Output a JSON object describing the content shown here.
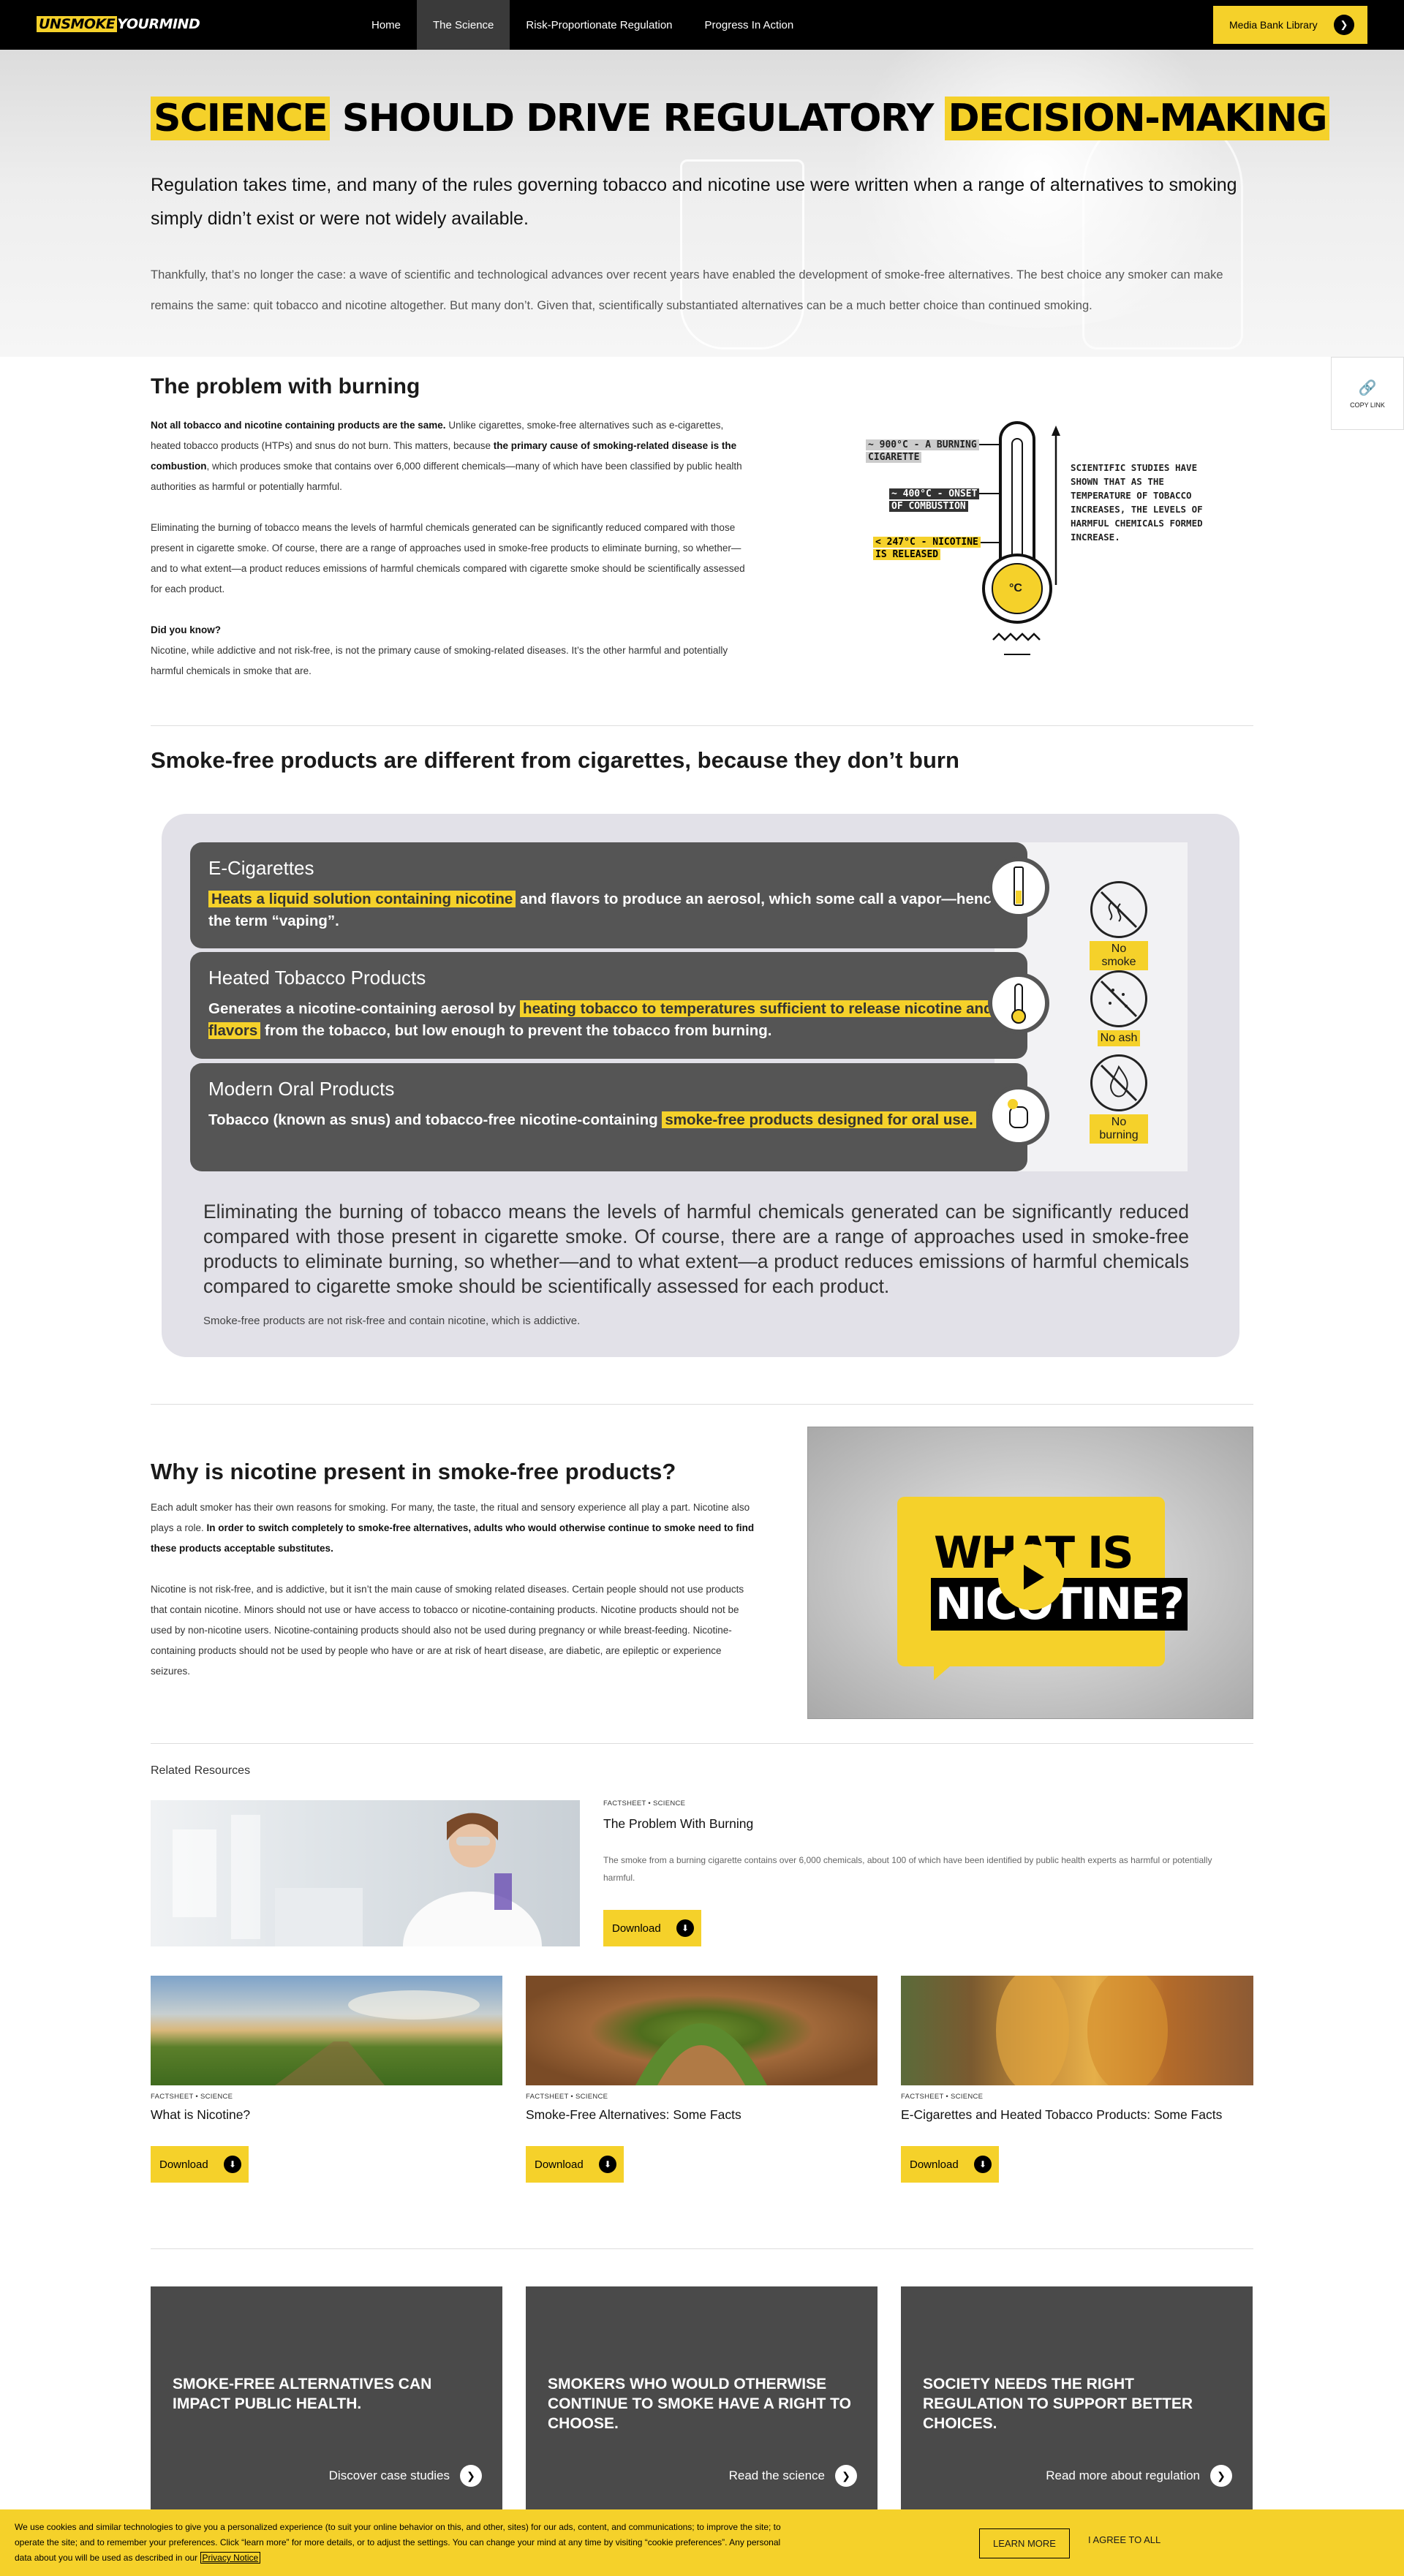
{
  "nav": {
    "logo_pre": "UNSMOKE",
    "logo_post": "YOURMIND",
    "links": [
      "Home",
      "The Science",
      "Risk-Proportionate Regulation",
      "Progress In Action"
    ],
    "media_button": "Media Bank Library"
  },
  "hero": {
    "title_hl1": "SCIENCE",
    "title_mid": " SHOULD DRIVE REGULATORY ",
    "title_hl2": "DECISION-MAKING",
    "lead": "Regulation takes time, and many of the rules governing tobacco and nicotine use were written when a range of alternatives to smoking simply didn’t exist or were not widely available.",
    "body": "Thankfully, that’s no longer the case: a wave of scientific and technological advances over recent years have enabled the development of smoke-free alternatives. The best choice any smoker can make remains the same: quit tobacco and nicotine altogether. But many don’t. Given that, scientifically substantiated alternatives can be a much better choice than continued smoking."
  },
  "copy_link": "COPY LINK",
  "problem": {
    "title": "The problem with burning",
    "p1_b1": "Not all tobacco and nicotine containing products are the same.",
    "p1_t1": " Unlike cigarettes, smoke-free alternatives such as e-cigarettes, heated tobacco products (HTPs) and snus do not burn. This matters, because ",
    "p1_b2": "the primary cause of smoking-related disease is the combustion",
    "p1_t2": ", which produces smoke that contains over 6,000 different chemicals—many of which have been classified by public health authorities as harmful or potentially harmful.",
    "p2": "Eliminating the burning of tobacco means the levels of harmful chemicals generated can be significantly reduced compared with those present in cigarette smoke. Of course, there are a range of approaches used in smoke-free products to eliminate burning, so whether—and to what extent—a product reduces emissions of harmful chemicals compared with cigarette smoke should be scientifically assessed for each product.",
    "p3_b": "Did you know?",
    "p3": "Nicotine, while addictive and not risk-free, is not the primary cause of smoking-related diseases. It’s the other harmful and potentially harmful chemicals in smoke that are."
  },
  "thermometer": {
    "l1a": "~ 900°C - A BURNING",
    "l1b": "CIGARETTE",
    "l2a": "~ 400°C - ONSET",
    "l2b": "OF COMBUSTION",
    "l3a": "< 247°C - NICOTINE",
    "l3b": "IS RELEASED",
    "note": "SCIENTIFIC STUDIES HAVE SHOWN THAT AS THE TEMPERATURE OF TOBACCO INCREASES, THE LEVELS OF HARMFUL CHEMICALS FORMED INCREASE.",
    "unit": "°C"
  },
  "smoke_free": {
    "title": "Smoke-free products are different from cigarettes, because they don’t burn",
    "cards": [
      {
        "title": "E-Cigarettes",
        "hl": "Heats a liquid solution containing nicotine",
        "rest": " and flavors to produce an aerosol, which some call a vapor—hence the term “vaping”."
      },
      {
        "title": "Heated Tobacco Products",
        "pre": "Generates a nicotine-containing aerosol by ",
        "hl": "heating tobacco to temperatures sufficient to release nicotine and flavors",
        "rest": " from the tobacco, but low enough to prevent the tobacco from burning."
      },
      {
        "title": "Modern Oral Products",
        "pre": "Tobacco (known as snus) and tobacco-free nicotine-containing ",
        "hl": "smoke-free products designed for oral use."
      }
    ],
    "badges": [
      "No smoke",
      "No ash",
      "No burning"
    ],
    "text": "Eliminating the burning of tobacco means the levels of harmful chemicals generated can be significantly reduced compared with those present in cigarette smoke. Of course, there are a range of approaches used in smoke-free products to eliminate burning, so whether—and to what extent—a product reduces emissions of harmful chemicals compared to cigarette smoke should be scientifically assessed for each product.",
    "foot": "Smoke-free products are not risk-free and contain nicotine, which is addictive."
  },
  "nicotine": {
    "title": "Why is nicotine present in smoke-free products?",
    "p1_t": "Each adult smoker has their own reasons for smoking. For many, the taste, the ritual and sensory experience all play a part. Nicotine also plays a role. ",
    "p1_b": "In order to switch completely to smoke-free alternatives, adults who would otherwise continue to smoke need to find these products acceptable substitutes.",
    "p2": "Nicotine is not risk-free, and is addictive, but it isn’t the main cause of smoking related diseases. Certain people should not use products that contain nicotine. Minors should not use or have access to tobacco or nicotine-containing products. Nicotine products should not be used by non-nicotine users. Nicotine-containing products should also not be used during pregnancy or while breast-feeding. Nicotine-containing products should not be used by people who have or are at risk of heart disease, are diabetic, are epileptic or experience seizures.",
    "video_line1": "WHAT IS",
    "video_line2": "NICOTINE?"
  },
  "resources": {
    "title": "Related Resources",
    "download": "Download",
    "featured": {
      "tag": "FACTSHEET • SCIENCE",
      "title": "The Problem With Burning",
      "desc": "The smoke from a burning cigarette contains over 6,000 chemicals, about 100 of which have been identified by public health experts as harmful or potentially harmful."
    },
    "items": [
      {
        "tag": "FACTSHEET • SCIENCE",
        "title": "What is Nicotine?"
      },
      {
        "tag": "FACTSHEET • SCIENCE",
        "title": "Smoke-Free Alternatives: Some Facts"
      },
      {
        "tag": "FACTSHEET • SCIENCE",
        "title": "E-Cigarettes and Heated Tobacco Products: Some Facts"
      }
    ]
  },
  "cta": [
    {
      "title": "SMOKE-FREE ALTERNATIVES CAN IMPACT PUBLIC HEALTH.",
      "link": "Discover case studies"
    },
    {
      "title": "SMOKERS WHO WOULD OTHERWISE CONTINUE TO SMOKE HAVE A RIGHT TO CHOOSE.",
      "link": "Read the science"
    },
    {
      "title": "SOCIETY NEEDS THE RIGHT REGULATION TO SUPPORT BETTER CHOICES.",
      "link": "Read more about regulation"
    }
  ],
  "cookie": {
    "text": "We use cookies and similar technologies to give you a personalized experience (to suit your online behavior on this, and other, sites) for our ads, content, and communications; to improve the site; to operate the site; and to remember your preferences. Click “learn more” for more details, or to adjust the settings. You can change your mind at any time by visiting “cookie preferences”. Any personal data about you will be used as described in our ",
    "link": "Privacy Notice",
    "learn": "LEARN MORE",
    "agree": "I AGREE TO ALL"
  },
  "colors": {
    "accent": "#f5d12a",
    "dark": "#4a4a4a",
    "nav": "#000000"
  }
}
